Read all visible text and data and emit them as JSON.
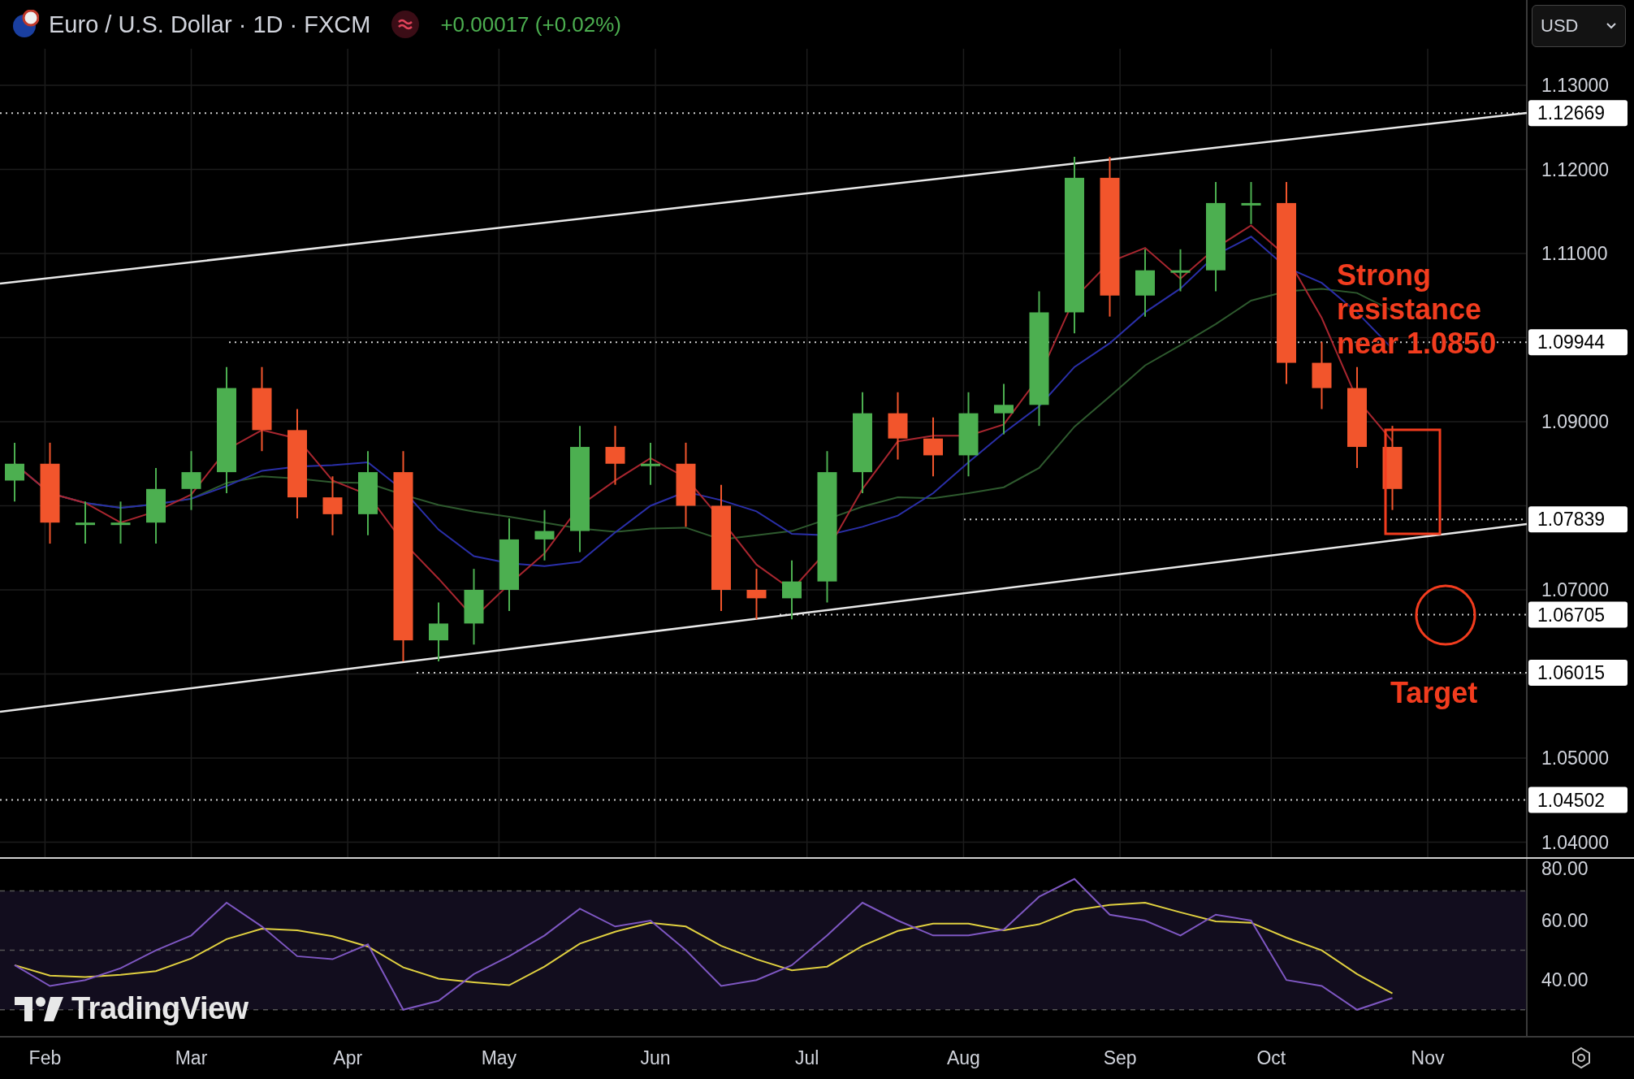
{
  "header": {
    "symbol": "Euro / U.S. Dollar · 1D · FXCM",
    "change": "+0.00017 (+0.02%)"
  },
  "currency_menu": {
    "value": "USD"
  },
  "price_axis": {
    "labels": [
      "1.13000",
      "1.12000",
      "1.11000",
      "1.09000",
      "1.07000",
      "1.05000",
      "1.04000"
    ]
  },
  "price_levels": [
    {
      "label": "1.12669"
    },
    {
      "label": "1.09944"
    },
    {
      "label": "1.07839"
    },
    {
      "label": "1.06705"
    },
    {
      "label": "1.06015"
    },
    {
      "label": "1.04502"
    }
  ],
  "notes": [
    {
      "text": "Strong resistance near 1.0850"
    },
    {
      "text": "Target"
    }
  ],
  "rsi_axis": {
    "labels": [
      "80.00",
      "60.00",
      "40.00"
    ]
  },
  "time_axis": {
    "labels": [
      "Feb",
      "Mar",
      "Apr",
      "May",
      "Jun",
      "Jul",
      "Aug",
      "Sep",
      "Oct",
      "Nov"
    ]
  },
  "brand": "TradingView"
}
